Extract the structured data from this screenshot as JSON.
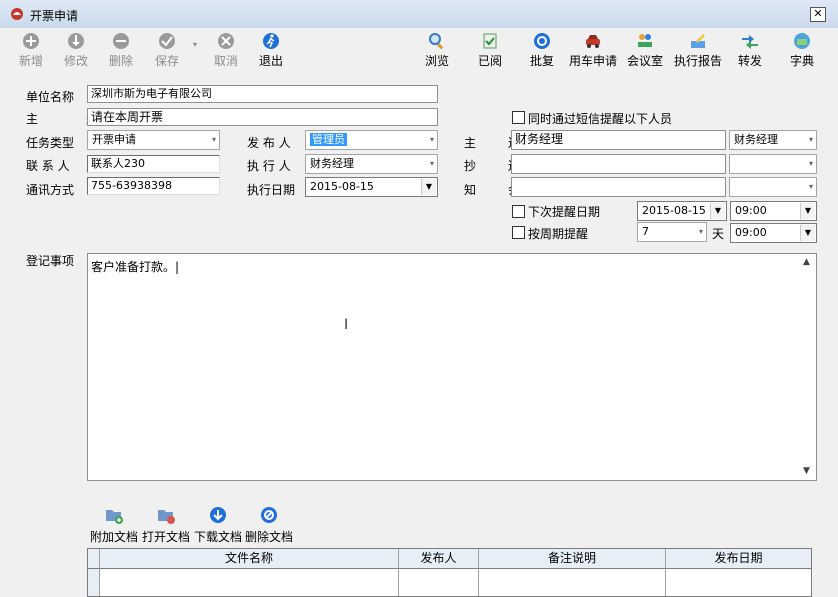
{
  "window": {
    "title": "开票申请",
    "close_glyph": "✕"
  },
  "toolbar": {
    "left": [
      {
        "name": "add-button",
        "label": "新增",
        "icon": "plus-circle-icon",
        "enabled": false
      },
      {
        "name": "edit-button",
        "label": "修改",
        "icon": "edit-circle-icon",
        "enabled": false
      },
      {
        "name": "delete-button",
        "label": "删除",
        "icon": "minus-circle-icon",
        "enabled": false
      },
      {
        "name": "save-button",
        "label": "保存",
        "icon": "check-circle-icon",
        "enabled": false
      },
      {
        "name": "cancel-button",
        "label": "取消",
        "icon": "x-circle-icon",
        "enabled": false
      },
      {
        "name": "exit-button",
        "label": "退出",
        "icon": "run-exit-icon",
        "enabled": true
      }
    ],
    "right": [
      {
        "name": "browse-button",
        "label": "浏览",
        "icon": "magnifier-icon"
      },
      {
        "name": "read-button",
        "label": "已阅",
        "icon": "read-doc-icon"
      },
      {
        "name": "approve-button",
        "label": "批复",
        "icon": "reply-icon"
      },
      {
        "name": "car-request-button",
        "label": "用车申请",
        "icon": "car-icon"
      },
      {
        "name": "meeting-room-button",
        "label": "会议室",
        "icon": "meeting-icon"
      },
      {
        "name": "exec-report-button",
        "label": "执行报告",
        "icon": "report-pen-icon"
      },
      {
        "name": "forward-button",
        "label": "转发",
        "icon": "forward-arrows-icon"
      },
      {
        "name": "dictionary-button",
        "label": "字典",
        "icon": "dictionary-icon"
      }
    ]
  },
  "form": {
    "unit_label": "单位名称",
    "unit_value": "深圳市斯为电子有限公司",
    "subject_label": "主　题",
    "subject_value": "请在本周开票",
    "task_type_label": "任务类型",
    "task_type_value": "开票申请",
    "contact_label": "联 系 人",
    "contact_value": "联系人230",
    "phone_label": "通讯方式",
    "phone_value": "755-63938398",
    "publisher_label": "发 布 人",
    "publisher_value": "管理员",
    "executor_label": "执 行 人",
    "executor_value": "财务经理",
    "exec_date_label": "执行日期",
    "exec_date_value": "2015-08-15",
    "sms_label": "同时通过短信提醒以下人员",
    "main_send_label": "主　送",
    "main_send_value": "财务经理",
    "main_send_combo": "财务经理",
    "cc_label": "抄　送",
    "notify_label": "知　会",
    "next_remind_label": "下次提醒日期",
    "next_remind_date": "2015-08-15",
    "next_remind_time": "09:00",
    "cycle_remind_label": "按周期提醒",
    "cycle_value": "7",
    "day_unit": "天",
    "cycle_time": "09:00",
    "notes_label": "登记事项",
    "notes_value": "客户准备打款。|"
  },
  "docs": {
    "attach_label": "附加文档",
    "open_label": "打开文档",
    "download_label": "下载文档",
    "delete_label": "删除文档"
  },
  "grid": {
    "columns": [
      "文件名称",
      "发布人",
      "备注说明",
      "发布日期"
    ]
  },
  "colors": {
    "accent": "#3399ff",
    "disabled_text": "#8d8d8d"
  }
}
